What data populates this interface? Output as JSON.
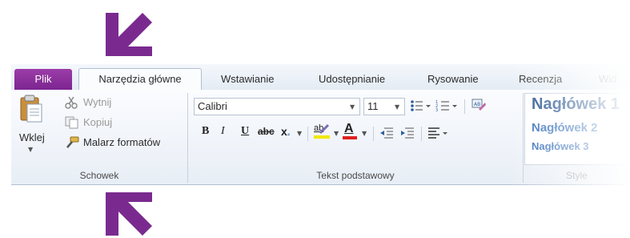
{
  "tabs": {
    "file": "Plik",
    "home": "Narzędzia główne",
    "insert": "Wstawianie",
    "share": "Udostępnianie",
    "draw": "Rysowanie",
    "review": "Recenzja",
    "view": "Wid"
  },
  "clipboard": {
    "paste": "Wklej",
    "cut": "Wytnij",
    "copy": "Kopiuj",
    "format_painter": "Malarz formatów",
    "group_label": "Schowek"
  },
  "basic_text": {
    "font": "Calibri",
    "size": "11",
    "bold": "B",
    "italic": "I",
    "underline": "U",
    "strike": "abc",
    "subscript": "x",
    "highlight": "ab",
    "font_color": "A",
    "group_label": "Tekst podstawowy"
  },
  "styles": {
    "heading1": "Nagłówek 1",
    "heading2": "Nagłówek 2",
    "heading3": "Nagłówek 3",
    "group_label": "Style"
  },
  "colors": {
    "accent": "#7a2a8f",
    "file_tab": "#8a2f9c",
    "heading": "#1f4e8c"
  }
}
